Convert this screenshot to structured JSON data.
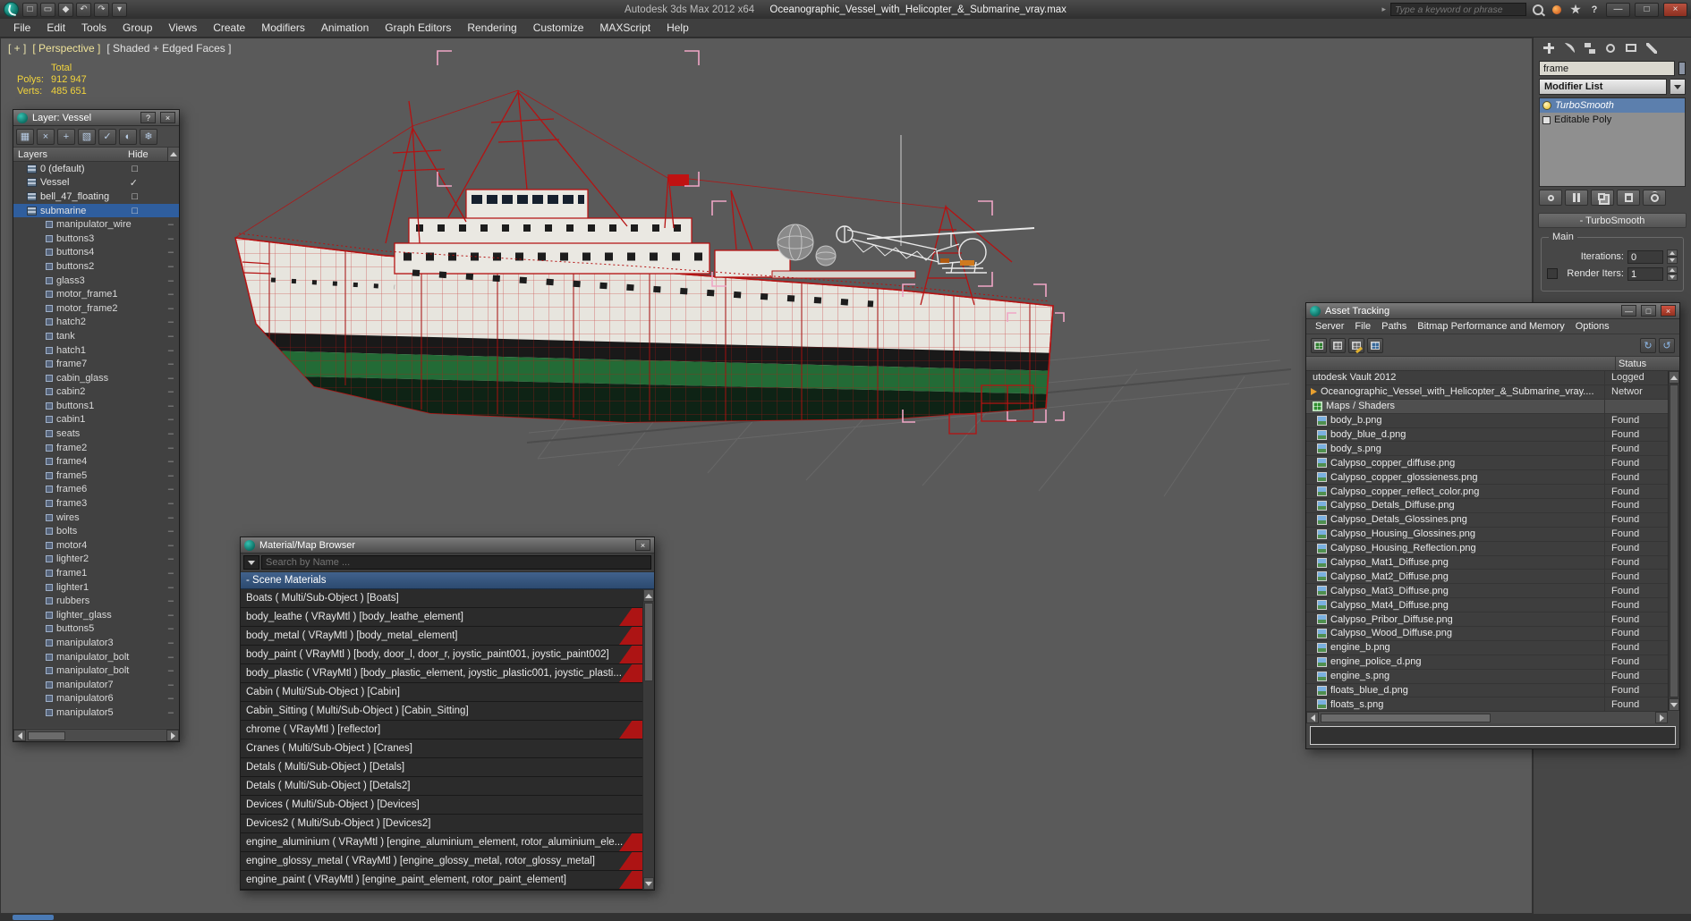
{
  "titlebar": {
    "app_title": "Autodesk 3ds Max 2012 x64",
    "doc_title": "Oceanographic_Vessel_with_Helicopter_&_Submarine_vray.max",
    "search_placeholder": "Type a keyword or phrase",
    "quick_icons": [
      {
        "name": "new-scene-icon",
        "glyph": "□"
      },
      {
        "name": "open-file-icon",
        "glyph": "▭"
      },
      {
        "name": "save-file-icon",
        "glyph": "◆"
      },
      {
        "name": "undo-icon",
        "glyph": "↶"
      },
      {
        "name": "redo-icon",
        "glyph": "↷"
      },
      {
        "name": "workspace-dropdown-icon",
        "glyph": "▾"
      }
    ],
    "window_buttons": {
      "minimize": "—",
      "maximize": "□",
      "close": "×"
    }
  },
  "menubar": {
    "items": [
      "File",
      "Edit",
      "Tools",
      "Group",
      "Views",
      "Create",
      "Modifiers",
      "Animation",
      "Graph Editors",
      "Rendering",
      "Customize",
      "MAXScript",
      "Help"
    ]
  },
  "viewport": {
    "label_general": "[ + ]",
    "label_pov": "[ Perspective ]",
    "label_shading": "[ Shaded + Edged Faces ]",
    "stats": {
      "total": "Total",
      "polys_label": "Polys:",
      "polys": "912 947",
      "verts_label": "Verts:",
      "verts": "485 651"
    }
  },
  "layer_dialog": {
    "title": "Layer: Vessel",
    "help_button": "?",
    "close_button": "×",
    "toolbar": [
      {
        "name": "create-new-layer-icon",
        "glyph": "▦"
      },
      {
        "name": "delete-layer-icon",
        "glyph": "×"
      },
      {
        "name": "add-selection-to-layer-icon",
        "glyph": "+"
      },
      {
        "name": "select-layer-objects-icon",
        "glyph": "▧"
      },
      {
        "name": "set-current-layer-icon",
        "glyph": "✓"
      },
      {
        "name": "hide-all-layers-icon",
        "glyph": "◐"
      },
      {
        "name": "freeze-all-layers-icon",
        "glyph": "❄"
      }
    ],
    "header": {
      "layers": "Layers",
      "hide": "Hide"
    },
    "rows": [
      {
        "name": "0 (default)",
        "cls": "row-layer",
        "marker": "□"
      },
      {
        "name": "Vessel",
        "cls": "row-layer",
        "marker": "✓"
      },
      {
        "name": "bell_47_floating",
        "cls": "row-layer",
        "marker": "□"
      },
      {
        "name": "submarine",
        "cls": "row-layer sel",
        "marker": "□"
      },
      {
        "name": "manipulator_wire",
        "cls": "row-obj",
        "marker": "–"
      },
      {
        "name": "buttons3",
        "cls": "row-obj",
        "marker": "–"
      },
      {
        "name": "buttons4",
        "cls": "row-obj",
        "marker": "–"
      },
      {
        "name": "buttons2",
        "cls": "row-obj",
        "marker": "–"
      },
      {
        "name": "glass3",
        "cls": "row-obj",
        "marker": "–"
      },
      {
        "name": "motor_frame1",
        "cls": "row-obj",
        "marker": "–"
      },
      {
        "name": "motor_frame2",
        "cls": "row-obj",
        "marker": "–"
      },
      {
        "name": "hatch2",
        "cls": "row-obj",
        "marker": "–"
      },
      {
        "name": "tank",
        "cls": "row-obj",
        "marker": "–"
      },
      {
        "name": "hatch1",
        "cls": "row-obj",
        "marker": "–"
      },
      {
        "name": "frame7",
        "cls": "row-obj",
        "marker": "–"
      },
      {
        "name": "cabin_glass",
        "cls": "row-obj",
        "marker": "–"
      },
      {
        "name": "cabin2",
        "cls": "row-obj",
        "marker": "–"
      },
      {
        "name": "buttons1",
        "cls": "row-obj",
        "marker": "–"
      },
      {
        "name": "cabin1",
        "cls": "row-obj",
        "marker": "–"
      },
      {
        "name": "seats",
        "cls": "row-obj",
        "marker": "–"
      },
      {
        "name": "frame2",
        "cls": "row-obj",
        "marker": "–"
      },
      {
        "name": "frame4",
        "cls": "row-obj",
        "marker": "–"
      },
      {
        "name": "frame5",
        "cls": "row-obj",
        "marker": "–"
      },
      {
        "name": "frame6",
        "cls": "row-obj",
        "marker": "–"
      },
      {
        "name": "frame3",
        "cls": "row-obj",
        "marker": "–"
      },
      {
        "name": "wires",
        "cls": "row-obj",
        "marker": "–"
      },
      {
        "name": "bolts",
        "cls": "row-obj",
        "marker": "–"
      },
      {
        "name": "motor4",
        "cls": "row-obj",
        "marker": "–"
      },
      {
        "name": "lighter2",
        "cls": "row-obj",
        "marker": "–"
      },
      {
        "name": "frame1",
        "cls": "row-obj",
        "marker": "–"
      },
      {
        "name": "lighter1",
        "cls": "row-obj",
        "marker": "–"
      },
      {
        "name": "rubbers",
        "cls": "row-obj",
        "marker": "–"
      },
      {
        "name": "lighter_glass",
        "cls": "row-obj",
        "marker": "–"
      },
      {
        "name": "buttons5",
        "cls": "row-obj",
        "marker": "–"
      },
      {
        "name": "manipulator3",
        "cls": "row-obj",
        "marker": "–"
      },
      {
        "name": "manipulator_bolt",
        "cls": "row-obj",
        "marker": "–"
      },
      {
        "name": "manipulator_bolt",
        "cls": "row-obj",
        "marker": "–"
      },
      {
        "name": "manipulator7",
        "cls": "row-obj",
        "marker": "–"
      },
      {
        "name": "manipulator6",
        "cls": "row-obj",
        "marker": "–"
      },
      {
        "name": "manipulator5",
        "cls": "row-obj",
        "marker": "–"
      }
    ]
  },
  "material_browser": {
    "title": "Material/Map Browser",
    "close_button": "×",
    "search_placeholder": "Search by Name ...",
    "section_header": "- Scene Materials",
    "rows": [
      {
        "text": "Boats ( Multi/Sub-Object ) [Boats]",
        "cls": ""
      },
      {
        "text": "body_leathe ( VRayMtl ) [body_leathe_element]",
        "cls": "has-sliver"
      },
      {
        "text": "body_metal ( VRayMtl ) [body_metal_element]",
        "cls": "has-sliver"
      },
      {
        "text": "body_paint ( VRayMtl ) [body, door_l, door_r, joystic_paint001, joystic_paint002]",
        "cls": "has-sliver"
      },
      {
        "text": "body_plastic ( VRayMtl ) [body_plastic_element, joystic_plastic001, joystic_plasti...",
        "cls": "has-sliver"
      },
      {
        "text": "Cabin ( Multi/Sub-Object ) [Cabin]",
        "cls": ""
      },
      {
        "text": "Cabin_Sitting ( Multi/Sub-Object ) [Cabin_Sitting]",
        "cls": ""
      },
      {
        "text": "chrome ( VRayMtl ) [reflector]",
        "cls": "has-sliver"
      },
      {
        "text": "Cranes ( Multi/Sub-Object ) [Cranes]",
        "cls": ""
      },
      {
        "text": "Detals ( Multi/Sub-Object ) [Detals]",
        "cls": ""
      },
      {
        "text": "Detals ( Multi/Sub-Object ) [Detals2]",
        "cls": ""
      },
      {
        "text": "Devices ( Multi/Sub-Object ) [Devices]",
        "cls": ""
      },
      {
        "text": "Devices2 ( Multi/Sub-Object ) [Devices2]",
        "cls": ""
      },
      {
        "text": "engine_aluminium ( VRayMtl ) [engine_aluminium_element, rotor_aluminium_ele...",
        "cls": "has-sliver"
      },
      {
        "text": "engine_glossy_metal ( VRayMtl ) [engine_glossy_metal, rotor_glossy_metal]",
        "cls": "has-sliver"
      },
      {
        "text": "engine_paint ( VRayMtl ) [engine_paint_element, rotor_paint_element]",
        "cls": "has-sliver"
      }
    ]
  },
  "asset_tracking": {
    "title": "Asset Tracking",
    "menu": [
      "Server",
      "File",
      "Paths",
      "Bitmap Performance and Memory",
      "Options"
    ],
    "status_header": "Status",
    "window_buttons": {
      "minimize": "—",
      "maximize": "□",
      "close": "×"
    },
    "rows": [
      {
        "name": "utodesk Vault 2012",
        "status": "Logged",
        "icon": "ic-none",
        "cls": ""
      },
      {
        "name": "Oceanographic_Vessel_with_Helicopter_&_Submarine_vray....",
        "status": "Networ",
        "icon": "ic-arrow",
        "cls": ""
      },
      {
        "name": "Maps / Shaders",
        "status": "",
        "icon": "ic-maps",
        "cls": "row-group"
      },
      {
        "name": "body_b.png",
        "status": "Found",
        "icon": "ic-img",
        "cls": ""
      },
      {
        "name": "body_blue_d.png",
        "status": "Found",
        "icon": "ic-img",
        "cls": ""
      },
      {
        "name": "body_s.png",
        "status": "Found",
        "icon": "ic-img",
        "cls": ""
      },
      {
        "name": "Calypso_copper_diffuse.png",
        "status": "Found",
        "icon": "ic-img",
        "cls": ""
      },
      {
        "name": "Calypso_copper_glossieness.png",
        "status": "Found",
        "icon": "ic-img",
        "cls": ""
      },
      {
        "name": "Calypso_copper_reflect_color.png",
        "status": "Found",
        "icon": "ic-img",
        "cls": ""
      },
      {
        "name": "Calypso_Detals_Diffuse.png",
        "status": "Found",
        "icon": "ic-img",
        "cls": ""
      },
      {
        "name": "Calypso_Detals_Glossines.png",
        "status": "Found",
        "icon": "ic-img",
        "cls": ""
      },
      {
        "name": "Calypso_Housing_Glossines.png",
        "status": "Found",
        "icon": "ic-img",
        "cls": ""
      },
      {
        "name": "Calypso_Housing_Reflection.png",
        "status": "Found",
        "icon": "ic-img",
        "cls": ""
      },
      {
        "name": "Calypso_Mat1_Diffuse.png",
        "status": "Found",
        "icon": "ic-img",
        "cls": ""
      },
      {
        "name": "Calypso_Mat2_Diffuse.png",
        "status": "Found",
        "icon": "ic-img",
        "cls": ""
      },
      {
        "name": "Calypso_Mat3_Diffuse.png",
        "status": "Found",
        "icon": "ic-img",
        "cls": ""
      },
      {
        "name": "Calypso_Mat4_Diffuse.png",
        "status": "Found",
        "icon": "ic-img",
        "cls": ""
      },
      {
        "name": "Calypso_Pribor_Diffuse.png",
        "status": "Found",
        "icon": "ic-img",
        "cls": ""
      },
      {
        "name": "Calypso_Wood_Diffuse.png",
        "status": "Found",
        "icon": "ic-img",
        "cls": ""
      },
      {
        "name": "engine_b.png",
        "status": "Found",
        "icon": "ic-img",
        "cls": ""
      },
      {
        "name": "engine_police_d.png",
        "status": "Found",
        "icon": "ic-img",
        "cls": ""
      },
      {
        "name": "engine_s.png",
        "status": "Found",
        "icon": "ic-img",
        "cls": ""
      },
      {
        "name": "floats_blue_d.png",
        "status": "Found",
        "icon": "ic-img",
        "cls": ""
      },
      {
        "name": "floats_s.png",
        "status": "Found",
        "icon": "ic-img",
        "cls": ""
      }
    ]
  },
  "command_panel": {
    "tabs": [
      {
        "name": "create-tab-icon",
        "cls": "ti-create"
      },
      {
        "name": "modify-tab-icon",
        "cls": "ti-modify"
      },
      {
        "name": "hierarchy-tab-icon",
        "cls": "ti-hier"
      },
      {
        "name": "motion-tab-icon",
        "cls": "ti-motion"
      },
      {
        "name": "display-tab-icon",
        "cls": "ti-display"
      },
      {
        "name": "utilities-tab-icon",
        "cls": "ti-util"
      }
    ],
    "object_name": "frame",
    "modifier_list_label": "Modifier List",
    "stack": [
      {
        "label": "TurboSmooth",
        "cls": "stack-selected",
        "icon": "bulb"
      },
      {
        "label": "Editable Poly",
        "cls": "",
        "icon": "epoly-ic"
      }
    ],
    "stack_buttons": [
      {
        "name": "pin-stack-button",
        "cls": "sb-pin"
      },
      {
        "name": "show-end-result-button",
        "cls": "sb-end"
      },
      {
        "name": "make-unique-button",
        "cls": "sb-uni"
      },
      {
        "name": "remove-modifier-button",
        "cls": "sb-del"
      },
      {
        "name": "configure-modifier-sets-button",
        "cls": "sb-cfg"
      }
    ],
    "rollout_title": "- TurboSmooth",
    "group_title": "Main",
    "iterations_label": "Iterations:",
    "iterations_value": "0",
    "render_iters_label": "Render Iters:",
    "render_iters_value": "1"
  },
  "scene": {
    "accent_wireframe_color": "#b51414",
    "selection_bracket_color": "#f0a6c6",
    "hull_green_color": "#236b36"
  }
}
